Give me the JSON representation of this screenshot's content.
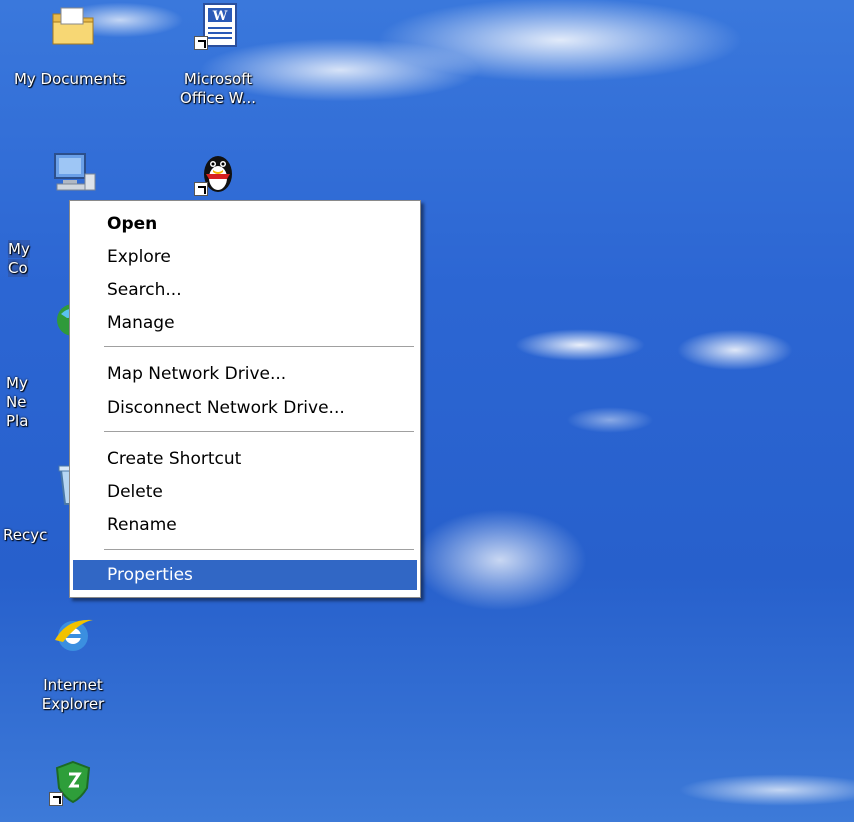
{
  "desktop": {
    "icons": [
      {
        "label": "My Documents",
        "icon": "folder-icon"
      },
      {
        "label": "Microsoft\nOffice W...",
        "icon": "word-icon"
      },
      {
        "label": "My Co",
        "icon": "computer-icon"
      },
      {
        "label": "",
        "icon": "qq-penguin-icon"
      },
      {
        "label": "My Ne\nPla",
        "icon": "network-places-icon"
      },
      {
        "label": "Recyc",
        "icon": "recycle-bin-icon"
      },
      {
        "label": "Internet\nExplorer",
        "icon": "internet-explorer-icon"
      },
      {
        "label": "",
        "icon": "security-shield-icon"
      }
    ]
  },
  "context_menu": {
    "items": [
      {
        "label": "Open",
        "bold": true
      },
      {
        "label": "Explore"
      },
      {
        "label": "Search..."
      },
      {
        "label": "Manage"
      },
      {
        "label": "Map Network Drive..."
      },
      {
        "label": "Disconnect Network Drive..."
      },
      {
        "label": "Create Shortcut"
      },
      {
        "label": "Delete"
      },
      {
        "label": "Rename"
      },
      {
        "label": "Properties",
        "highlighted": true
      }
    ]
  },
  "colors": {
    "highlight": "#3167c5",
    "desktop_blue": "#2c66d3"
  }
}
